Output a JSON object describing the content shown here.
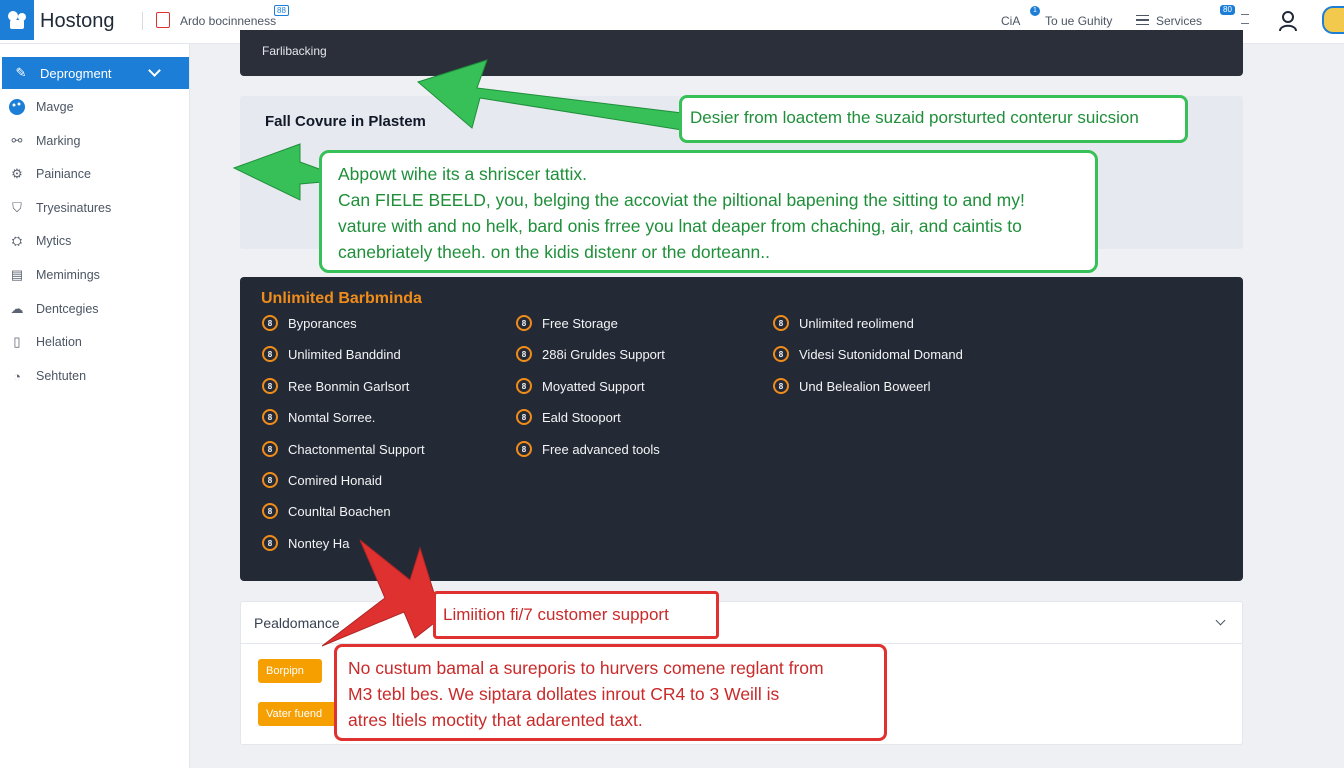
{
  "topbar": {
    "brand": "Hostong",
    "search_text": "Ardo bocinneness",
    "search_badge": "88",
    "links": [
      "CiA",
      "To ue Guhity",
      "Services"
    ],
    "notification_count": "1",
    "badge2": "80"
  },
  "sidebar": {
    "active_item": "Deprogment",
    "items": [
      {
        "label": "Mavge",
        "icon": "palette-icon"
      },
      {
        "label": "Marking",
        "icon": "handshake-icon"
      },
      {
        "label": "Painiance",
        "icon": "settings-icon"
      },
      {
        "label": "Tryesinatures",
        "icon": "shield-icon"
      },
      {
        "label": "Mytics",
        "icon": "chart-icon"
      },
      {
        "label": "Memimings",
        "icon": "document-icon"
      },
      {
        "label": "Dentcegies",
        "icon": "cloud-icon"
      },
      {
        "label": "Helation",
        "icon": "file-icon"
      },
      {
        "label": "Sehtuten",
        "icon": "clock-icon"
      }
    ]
  },
  "top_panel": {
    "label": "Farlibacking"
  },
  "info_panel": {
    "heading": "Fall Covure in Plastem"
  },
  "callouts": {
    "green_top": "Desier from loactem the suzaid porsturted conterur suicsion",
    "green_big": [
      "Abpowt wihe its a shriscer tattix.",
      "Can FIELE BEELD, you, belging the accoviat the piltional bapening the sitting to and my!",
      "vature with and no helk, bard onis frree you lnat deaper from chaching, air, and caintis to",
      "canebriately theeh. on the kidis distenr or the dorteann.."
    ],
    "red_top": "Limiition ﬁ/7 customer support",
    "red_big": [
      "No custum bamal a sureporis to hurvers comene reglant from",
      "M3 tebl bes. We siptara dollates inrout CR4 to 3 Weill is",
      "atres ltiels moctity that adarented taxt."
    ]
  },
  "features": {
    "title": "Unlimited  Barbminda",
    "bullet_glyph": "8",
    "col1": [
      "Byporances",
      "Unlimited Banddind",
      "Ree Bonmin Garlsort",
      "Nomtal Sorree.",
      "Chactonmental Support",
      "Comired Honaid",
      "Counltal Boachen",
      "Nontey Ha"
    ],
    "col2": [
      "Free Storage",
      "288i Gruldes Support",
      "Moyatted Support",
      "Eald Stooport",
      "Free advanced tools"
    ],
    "col3": [
      "Unlimited reolimend",
      "Videsi Sutonidomal Domand",
      "Und Belealion Boweerl"
    ]
  },
  "accordion": {
    "title": "Pealdomance",
    "buttons": [
      "Borpipn",
      "Vater fuend"
    ]
  },
  "colors": {
    "accent": "#1c7ed6",
    "orange": "#f08c1a",
    "callout_green": "#37c057",
    "callout_red": "#e03131",
    "dark_panel": "#242a35"
  }
}
